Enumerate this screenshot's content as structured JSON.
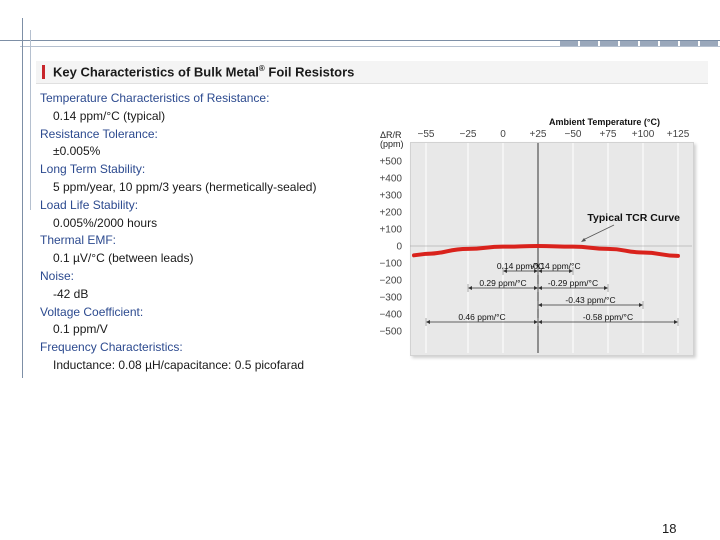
{
  "slide": {
    "title": "Key Characteristics of Bulk Metal",
    "title_mark": "®",
    "title_suffix": " Foil Resistors",
    "page_number": "18"
  },
  "specs": [
    {
      "label": "Temperature Characteristics of Resistance:",
      "value": "0.14 ppm/°C (typical)"
    },
    {
      "label": "Resistance Tolerance:",
      "value": "±0.005%"
    },
    {
      "label": "Long Term Stability:",
      "value": "5 ppm/year, 10 ppm/3 years (hermetically-sealed)"
    },
    {
      "label": "Load Life Stability:",
      "value": "0.005%/2000 hours"
    },
    {
      "label": "Thermal EMF:",
      "value": "0.1 µV/°C (between leads)"
    },
    {
      "label": "Noise:",
      "value": "-42 dB"
    },
    {
      "label": "Voltage Coefficient:",
      "value": "0.1 ppm/V"
    },
    {
      "label": "Frequency Characteristics:",
      "value": "Inductance: 0.08 µH/capacitance: 0.5 picofarad"
    }
  ],
  "chart_data": {
    "type": "line",
    "title": "Ambient Temperature (°C)",
    "ylabel_line1": "ΔR/R",
    "ylabel_line2": "(ppm)",
    "x_ticks": [
      "−55",
      "−25",
      "0",
      "+25",
      "−50",
      "+75",
      "+100",
      "+125"
    ],
    "y_ticks": [
      "+500",
      "+400",
      "+300",
      "+200",
      "+100",
      "0",
      "−100",
      "−200",
      "−300",
      "−400",
      "−500"
    ],
    "ylim": [
      -500,
      500
    ],
    "x": [
      -55,
      -25,
      0,
      25,
      50,
      75,
      100,
      125
    ],
    "series": [
      {
        "name": "Typical TCR Curve",
        "values": [
          -46,
          -17,
          -4,
          0,
          -4,
          -17,
          -38,
          -58
        ],
        "color": "#d9221c"
      }
    ],
    "annotations": [
      {
        "label": "0.14 ppm/°C",
        "x_from": 0,
        "x_to": 25,
        "y": -100
      },
      {
        "label": "-0.14 ppm/°C",
        "x_from": 25,
        "x_to": 50,
        "y": -100
      },
      {
        "label": "0.29 ppm/°C",
        "x_from": -25,
        "x_to": 25,
        "y": -200
      },
      {
        "label": "-0.29 ppm/°C",
        "x_from": 25,
        "x_to": 75,
        "y": -200
      },
      {
        "label": "-0.43 ppm/°C",
        "x_from": 25,
        "x_to": 100,
        "y": -300
      },
      {
        "label": "0.46 ppm/°C",
        "x_from": -55,
        "x_to": 25,
        "y": -400
      },
      {
        "label": "-0.58 ppm/°C",
        "x_from": 25,
        "x_to": 125,
        "y": -400
      }
    ]
  }
}
